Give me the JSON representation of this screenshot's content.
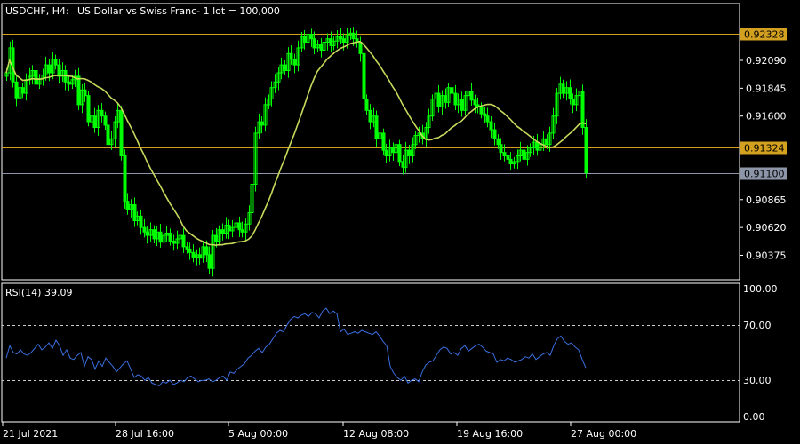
{
  "header": {
    "symbol": "USDCHF, H4:",
    "description": "US Dollar vs Swiss Franc- 1 lot = 100,000"
  },
  "chart_data": [
    {
      "type": "candlestick",
      "name": "price",
      "yticks": [
        "0.92090",
        "0.91845",
        "0.91600",
        "0.90865",
        "0.90620",
        "0.90375"
      ],
      "ylim": [
        0.9016,
        0.9259
      ],
      "colors": {
        "candle": "#00ff00",
        "ma": "#c8d85a",
        "level": "#d4a020",
        "bid": "#8c96a8",
        "grid": "#ffffff"
      },
      "levels": [
        {
          "price": 0.92328,
          "label": "0.92328",
          "kind": "level"
        },
        {
          "price": 0.91324,
          "label": "0.91324",
          "kind": "level"
        },
        {
          "price": 0.911,
          "label": "0.91100",
          "kind": "bid"
        }
      ],
      "close": [
        0.9198,
        0.922,
        0.919,
        0.9176,
        0.9185,
        0.918,
        0.9192,
        0.9195,
        0.92,
        0.9188,
        0.9193,
        0.9196,
        0.9205,
        0.9198,
        0.921,
        0.9205,
        0.9195,
        0.92,
        0.919,
        0.9188,
        0.9192,
        0.9195,
        0.917,
        0.9183,
        0.9178,
        0.9155,
        0.916,
        0.915,
        0.9165,
        0.916,
        0.9152,
        0.9135,
        0.914,
        0.9155,
        0.9165,
        0.9125,
        0.9085,
        0.9078,
        0.9082,
        0.9068,
        0.9072,
        0.9062,
        0.9058,
        0.9055,
        0.906,
        0.9052,
        0.9058,
        0.9049,
        0.9055,
        0.9057,
        0.905,
        0.9048,
        0.9052,
        0.9055,
        0.9045,
        0.9043,
        0.904,
        0.9036,
        0.9038,
        0.9035,
        0.9045,
        0.9038,
        0.9026,
        0.9055,
        0.905,
        0.906,
        0.9057,
        0.9064,
        0.9059,
        0.9062,
        0.9066,
        0.906,
        0.9058,
        0.9065,
        0.9075,
        0.91,
        0.9145,
        0.9155,
        0.9152,
        0.917,
        0.9175,
        0.9185,
        0.919,
        0.9198,
        0.9205,
        0.92,
        0.9215,
        0.921,
        0.9205,
        0.922,
        0.923,
        0.9225,
        0.9232,
        0.9228,
        0.922,
        0.9223,
        0.9218,
        0.9225,
        0.9228,
        0.9222,
        0.9226,
        0.923,
        0.9228,
        0.9225,
        0.9231,
        0.9233,
        0.9228,
        0.9225,
        0.9215,
        0.9175,
        0.9165,
        0.9155,
        0.916,
        0.914,
        0.9145,
        0.913,
        0.9125,
        0.9132,
        0.9128,
        0.9135,
        0.912,
        0.9115,
        0.913,
        0.9125,
        0.9135,
        0.9143,
        0.9145,
        0.914,
        0.915,
        0.916,
        0.9175,
        0.918,
        0.9168,
        0.9178,
        0.9172,
        0.9185,
        0.918,
        0.917,
        0.9175,
        0.9165,
        0.9178,
        0.9182,
        0.9174,
        0.917,
        0.9168,
        0.9162,
        0.916,
        0.9155,
        0.9148,
        0.914,
        0.9135,
        0.9128,
        0.9125,
        0.9122,
        0.9118,
        0.912,
        0.9125,
        0.913,
        0.9122,
        0.9128,
        0.9132,
        0.9137,
        0.913,
        0.9135,
        0.914,
        0.9135,
        0.9145,
        0.916,
        0.918,
        0.9188,
        0.918,
        0.9185,
        0.9175,
        0.917,
        0.9178,
        0.9182,
        0.915,
        0.911
      ]
    },
    {
      "type": "line",
      "name": "RSI(14)",
      "title": "RSI(14) 39.09",
      "yticks": [
        "100.00",
        "70.00",
        "30.00",
        "0.00"
      ],
      "ylim": [
        0,
        100
      ],
      "levels": [
        70,
        30
      ],
      "color": "#3a6fe0",
      "values": [
        46,
        55,
        50,
        49,
        52,
        49,
        48,
        50,
        53,
        56,
        52,
        54,
        57,
        53,
        59,
        55,
        48,
        52,
        46,
        45,
        48,
        50,
        40,
        47,
        45,
        38,
        44,
        40,
        46,
        43,
        40,
        36,
        39,
        42,
        44,
        38,
        32,
        34,
        33,
        30,
        32,
        28,
        27,
        26,
        29,
        28,
        30,
        27,
        28,
        30,
        29,
        32,
        33,
        31,
        29,
        30,
        30,
        31,
        29,
        30,
        32,
        33,
        30,
        36,
        35,
        38,
        40,
        42,
        46,
        48,
        51,
        53,
        50,
        54,
        56,
        60,
        64,
        66,
        65,
        70,
        74,
        76,
        75,
        77,
        78,
        76,
        79,
        78,
        75,
        80,
        82,
        78,
        80,
        78,
        65,
        67,
        63,
        64,
        65,
        64,
        66,
        65,
        64,
        63,
        65,
        62,
        58,
        55,
        40,
        35,
        32,
        30,
        33,
        28,
        30,
        31,
        29,
        36,
        41,
        43,
        44,
        48,
        52,
        54,
        53,
        49,
        50,
        48,
        53,
        55,
        51,
        53,
        55,
        56,
        54,
        51,
        50,
        49,
        43,
        45,
        44,
        46,
        45,
        43,
        44,
        45,
        47,
        46,
        49,
        45,
        47,
        49,
        50,
        48,
        55,
        60,
        62,
        58,
        56,
        57,
        54,
        52,
        45,
        39
      ]
    }
  ],
  "xaxis": {
    "labels": [
      "21 Jul 2021",
      "28 Jul 16:00",
      "5 Aug 00:00",
      "12 Aug 08:00",
      "19 Aug 16:00",
      "27 Aug 00:00"
    ]
  }
}
